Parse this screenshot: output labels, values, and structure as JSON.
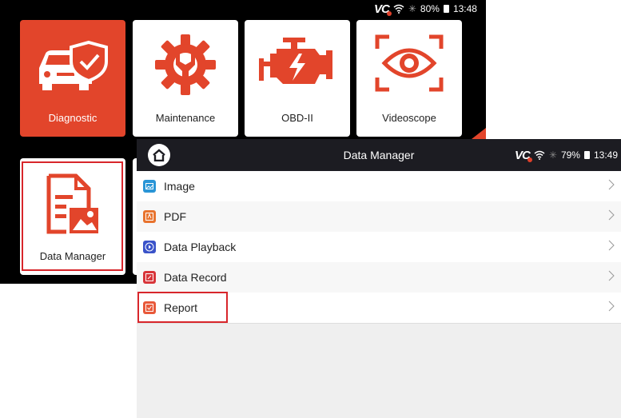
{
  "home": {
    "status": {
      "brand": "VC",
      "battery": "80%",
      "time": "13:48"
    },
    "tiles": [
      {
        "label": "Diagnostic",
        "icon": "car-shield-icon"
      },
      {
        "label": "Maintenance",
        "icon": "gear-wrench-icon"
      },
      {
        "label": "OBD-II",
        "icon": "engine-icon"
      },
      {
        "label": "Videoscope",
        "icon": "eye-scan-icon"
      },
      {
        "label": "Data Manager",
        "icon": "document-image-icon"
      }
    ]
  },
  "data_manager": {
    "title": "Data Manager",
    "status": {
      "brand": "VC",
      "battery": "79%",
      "time": "13:49"
    },
    "items": [
      {
        "label": "Image",
        "icon": "image-icon",
        "color": "#2a95d6"
      },
      {
        "label": "PDF",
        "icon": "pdf-icon",
        "color": "#e8732e"
      },
      {
        "label": "Data Playback",
        "icon": "play-icon",
        "color": "#3a53c9"
      },
      {
        "label": "Data Record",
        "icon": "record-icon",
        "color": "#d8353a"
      },
      {
        "label": "Report",
        "icon": "report-icon",
        "color": "#e8593a"
      }
    ]
  },
  "colors": {
    "accent": "#e2452b",
    "highlight": "#d8262b",
    "header": "#1c1c22"
  }
}
